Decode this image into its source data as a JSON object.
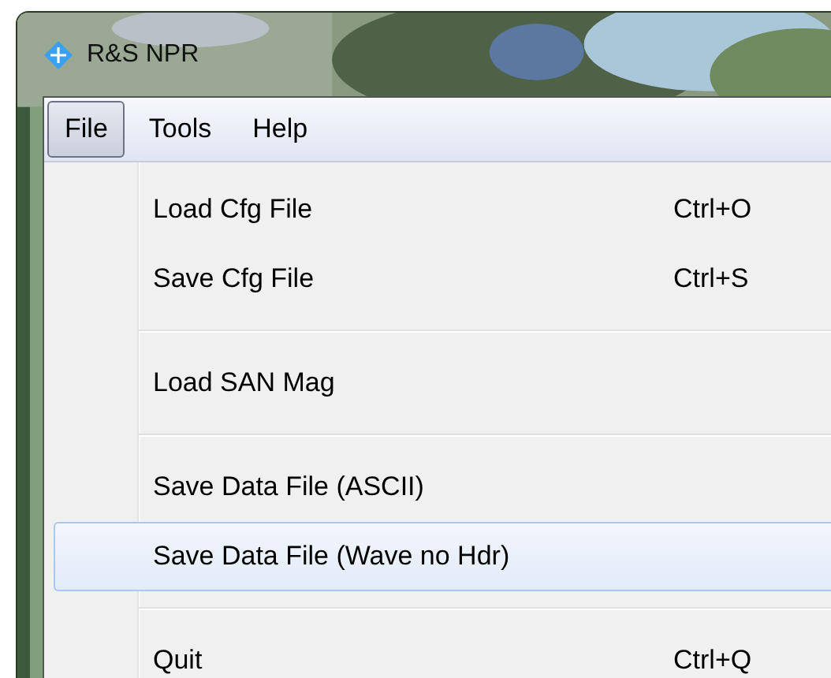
{
  "window": {
    "title": "R&S NPR"
  },
  "menu_bar": [
    {
      "label": "File",
      "selected": true
    },
    {
      "label": "Tools",
      "selected": false
    },
    {
      "label": "Help",
      "selected": false
    }
  ],
  "menu": {
    "items": [
      {
        "kind": "item",
        "label": "Load Cfg File",
        "shortcut": "Ctrl+O",
        "selected": false
      },
      {
        "kind": "item",
        "label": "Save Cfg File",
        "shortcut": "Ctrl+S",
        "selected": false
      },
      {
        "kind": "separator"
      },
      {
        "kind": "item",
        "label": "Load SAN Mag",
        "selected": false
      },
      {
        "kind": "separator"
      },
      {
        "kind": "item",
        "label": "Save Data File (ASCII)",
        "selected": false
      },
      {
        "kind": "item",
        "label": "Save Data File (Wave no Hdr)",
        "selected": true
      },
      {
        "kind": "separator"
      },
      {
        "kind": "item",
        "label": "Quit",
        "shortcut": "Ctrl+Q",
        "selected": false
      }
    ]
  }
}
